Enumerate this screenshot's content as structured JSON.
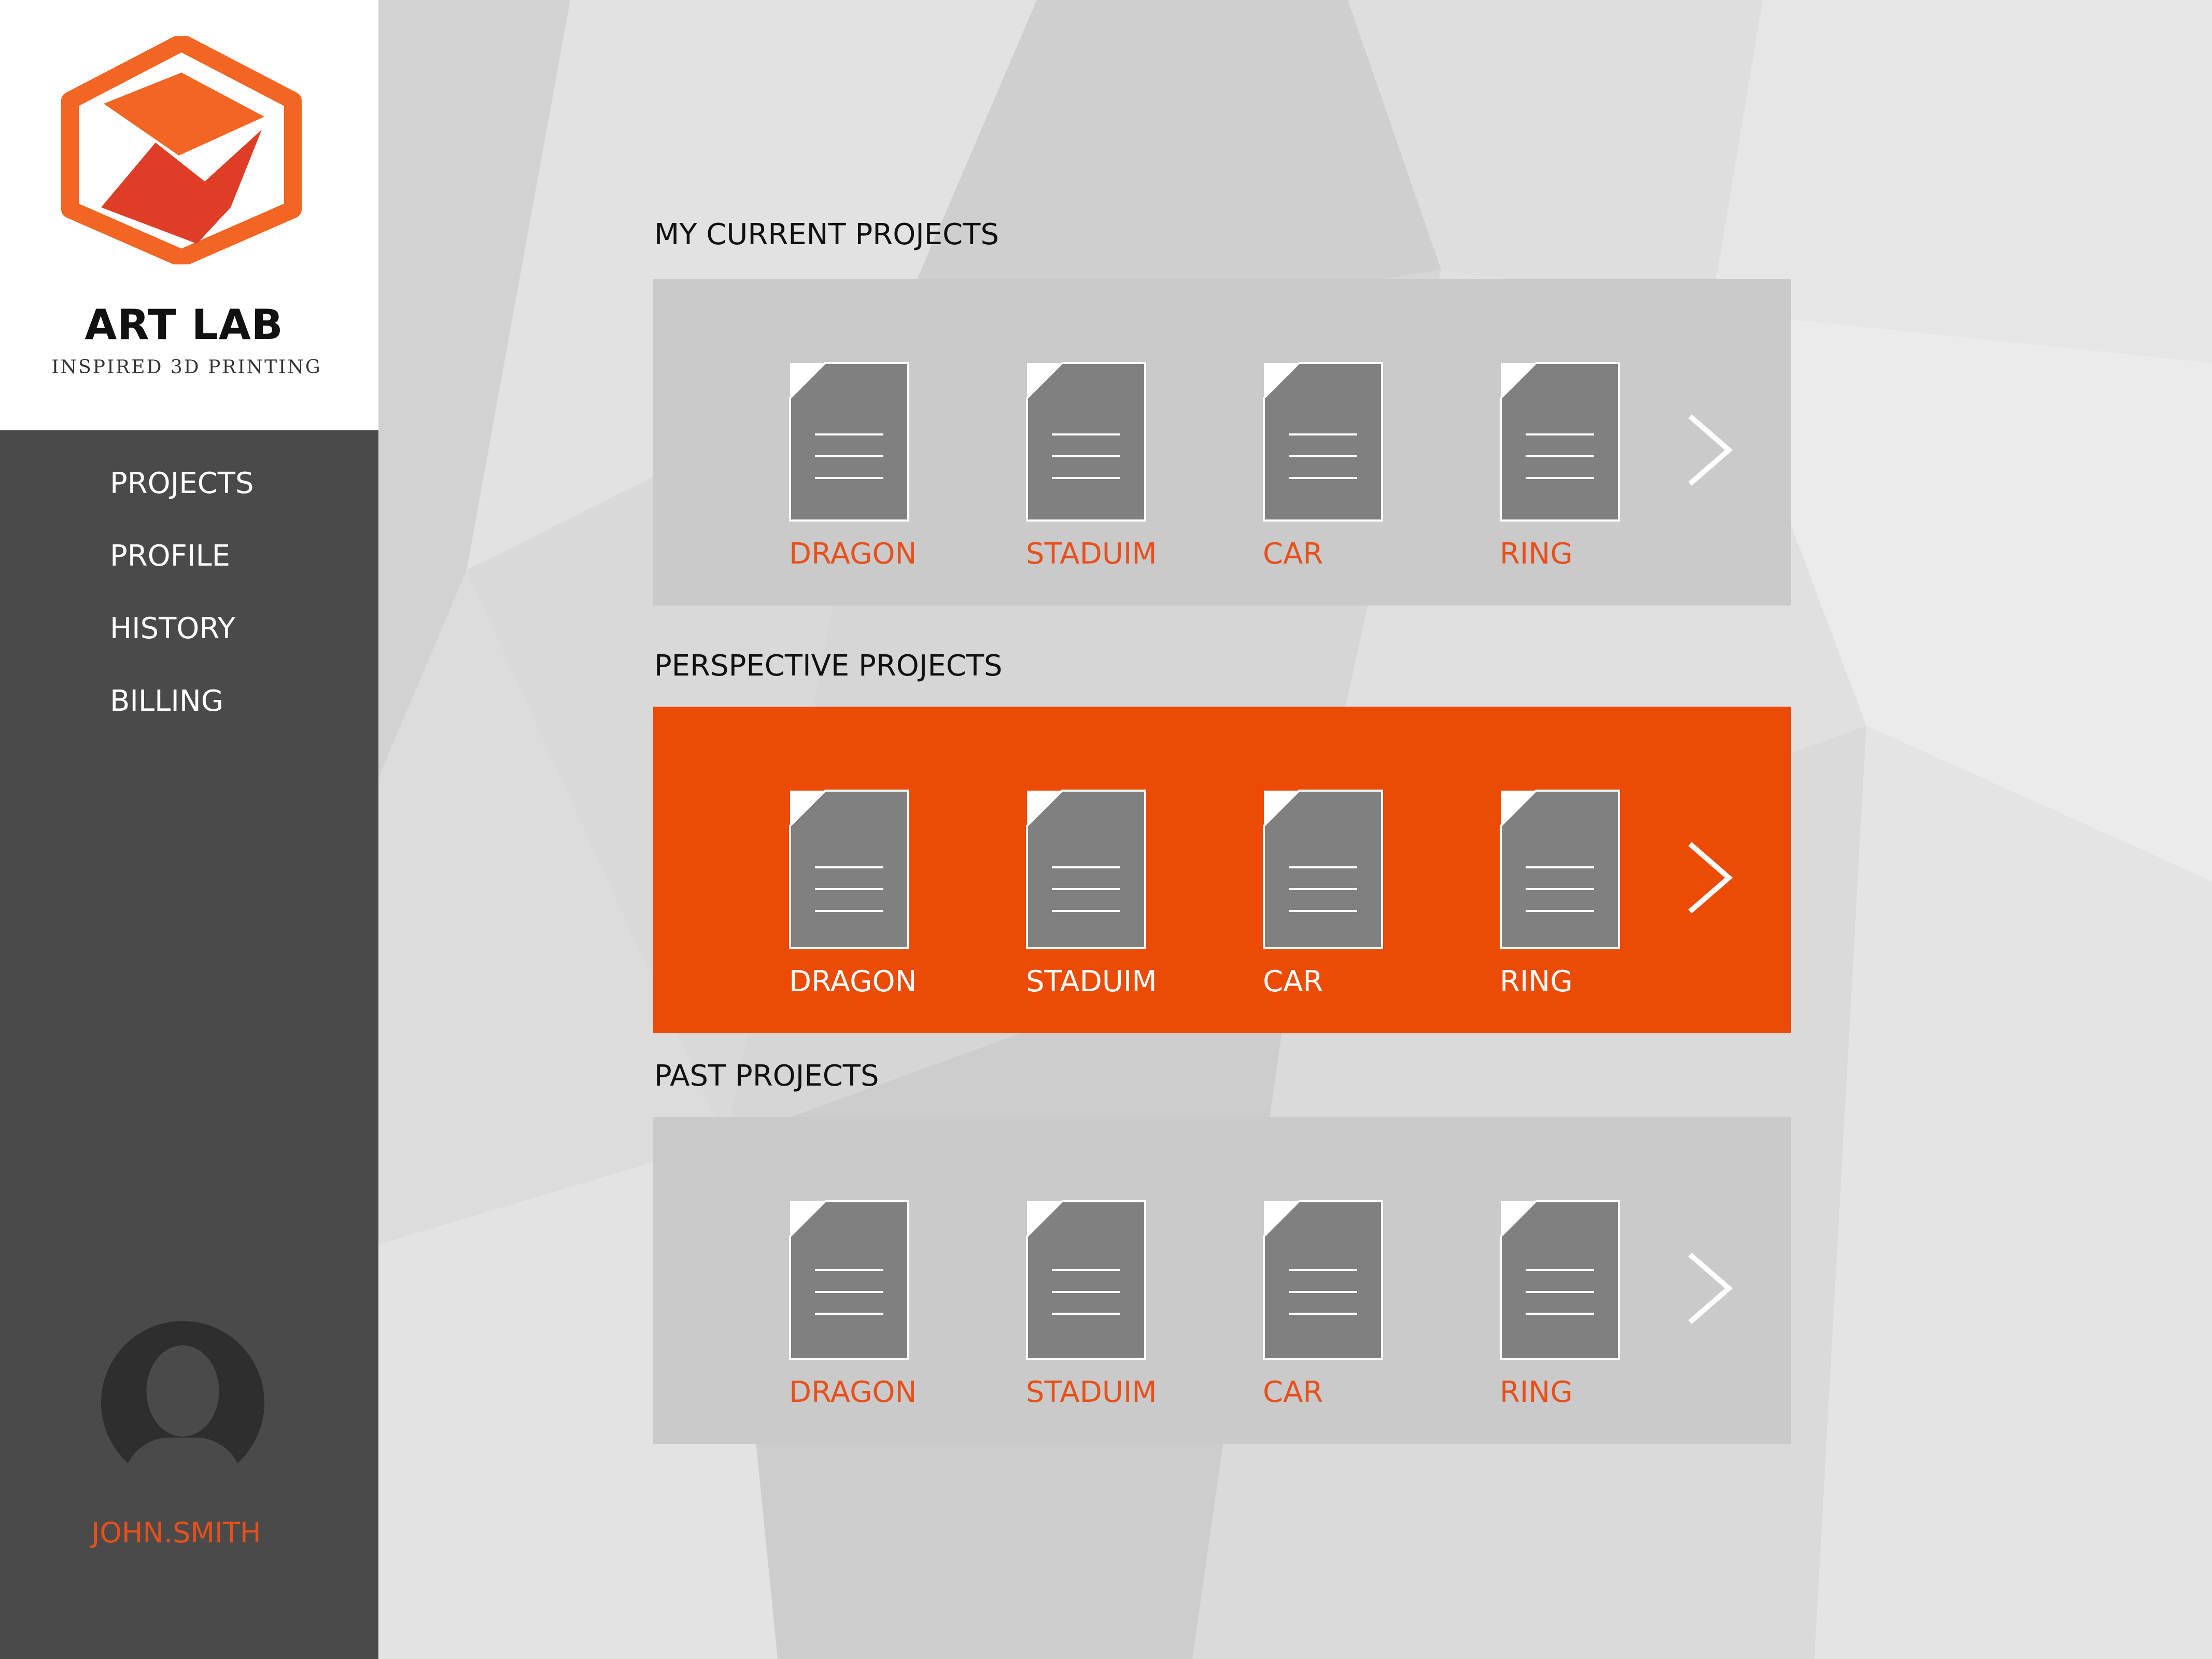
{
  "brand": {
    "name": "ART LAB",
    "tagline": "INSPIRED 3D PRINTING",
    "logo_icon": "hexagon-logo-icon"
  },
  "nav": {
    "items": [
      {
        "label": "PROJECTS"
      },
      {
        "label": "PROFILE"
      },
      {
        "label": "HISTORY"
      },
      {
        "label": "BILLING"
      }
    ]
  },
  "user": {
    "name": "JOHN.SMITH",
    "avatar_icon": "user-avatar-icon"
  },
  "sections": [
    {
      "title": "MY CURRENT PROJECTS",
      "highlighted": false,
      "projects": [
        "DRAGON",
        "STADUIM",
        "CAR",
        "RING"
      ]
    },
    {
      "title": "PERSPECTIVE PROJECTS",
      "highlighted": true,
      "projects": [
        "DRAGON",
        "STADUIM",
        "CAR",
        "RING"
      ]
    },
    {
      "title": "PAST PROJECTS",
      "highlighted": false,
      "projects": [
        "DRAGON",
        "STADUIM",
        "CAR",
        "RING"
      ]
    }
  ],
  "icons": {
    "project": "document-icon",
    "next": "chevron-right-icon"
  },
  "colors": {
    "accent": "#ec4b06",
    "accent_text": "#e8501a",
    "sidebar": "#4a4a4a",
    "panel": "#cacaca",
    "document": "#808080"
  }
}
